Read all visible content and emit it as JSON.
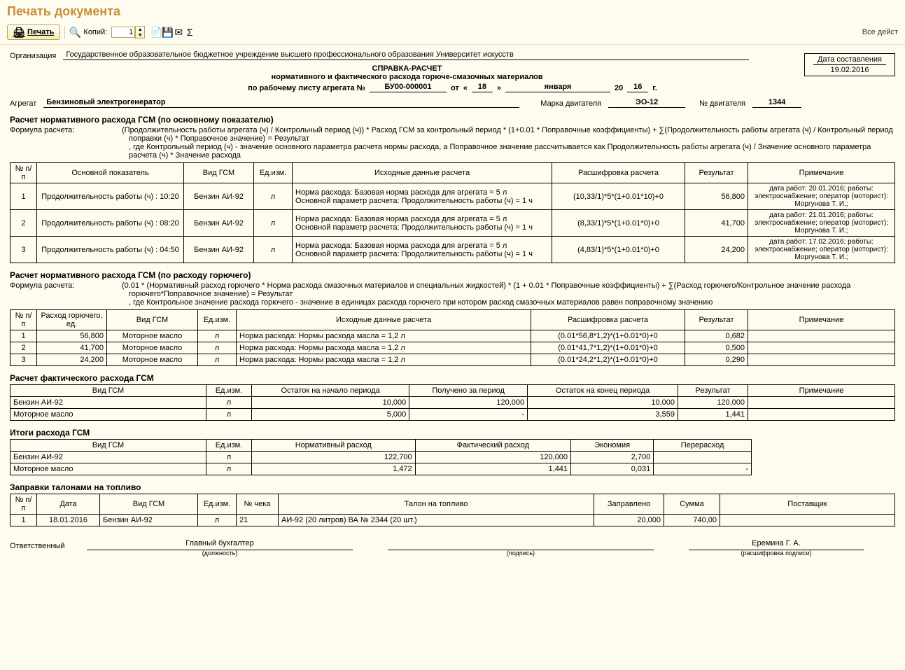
{
  "window_title": "Печать документа",
  "toolbar": {
    "print_label": "Печать",
    "copies_label": "Копий:",
    "copies_value": "1",
    "all_actions": "Все дейст"
  },
  "header": {
    "org_label": "Организация",
    "org_value": "Государственное образовательное бюджетное учреждение высшего профессионального образования  Университет искусств",
    "date_label": "Дата составления",
    "date_value": "19.02.2016",
    "title1": "СПРАВКА-РАСЧЕТ",
    "title2": "нормативного и фактического расхода горюче-смазочных материалов",
    "docline_prefix": "по рабочему листу агрегата  №",
    "doc_no": "БУ00-000001",
    "doc_ot": "от",
    "doc_day": "18",
    "doc_month": "января",
    "doc_year_prefix": "20",
    "doc_year": "16",
    "doc_year_suffix": "г.",
    "agg_label": "Агрегат",
    "agg_value": "Бензиновый электрогенератор",
    "engine_brand_label": "Марка двигателя",
    "engine_brand_value": "ЭО-12",
    "engine_no_label": "№ двигателя",
    "engine_no_value": "1344"
  },
  "section1": {
    "title": "Расчет нормативного расхода ГСМ (по основному показателю)",
    "formula_label": "Формула расчета:",
    "formula_text": "(Продолжительность работы агрегата (ч) / Контрольный период (ч)) * Расход ГСМ за контрольный период * (1+0.01 * Поправочные коэффициенты) + ∑(Продолжительность работы агрегата (ч) / Контрольный период поправки (ч) * Поправочное значение) = Результат\n, где Контрольный период (ч) - значение основного параметра расчета нормы расхода, а Поправочное значение рассчитывается как Продолжительность работы агрегата (ч) / Значение основного параметра расчета (ч) * Значение расхода",
    "cols": [
      "№ п/п",
      "Основной показатель",
      "Вид ГСМ",
      "Ед.изм.",
      "Исходные данные расчета",
      "Расшифровка расчета",
      "Результат",
      "Примечание"
    ],
    "rows": [
      {
        "n": "1",
        "ind": "Продолжительность работы (ч) : 10:20",
        "gsm": "Бензин АИ-92",
        "unit": "л",
        "src": "Норма расхода: Базовая норма расхода для агрегата = 5 л\nОсновной параметр расчета: Продолжительность работы (ч) = 1 ч",
        "calc": "(10,33/1)*5*(1+0.01*10)+0",
        "res": "56,800",
        "note": "дата работ: 20.01.2016; работы: электроснабжение; оператор (моторист): Моргунова Т. И.;"
      },
      {
        "n": "2",
        "ind": "Продолжительность работы (ч) : 08:20",
        "gsm": "Бензин АИ-92",
        "unit": "л",
        "src": "Норма расхода: Базовая норма расхода для агрегата = 5 л\nОсновной параметр расчета: Продолжительность работы (ч) = 1 ч",
        "calc": "(8,33/1)*5*(1+0.01*0)+0",
        "res": "41,700",
        "note": "дата работ: 21.01.2016; работы: электроснабжение; оператор (моторист): Моргунова Т. И.;"
      },
      {
        "n": "3",
        "ind": "Продолжительность работы (ч) : 04:50",
        "gsm": "Бензин АИ-92",
        "unit": "л",
        "src": "Норма расхода: Базовая норма расхода для агрегата = 5 л\nОсновной параметр расчета: Продолжительность работы (ч) = 1 ч",
        "calc": "(4,83/1)*5*(1+0.01*0)+0",
        "res": "24,200",
        "note": "дата работ: 17.02.2016; работы: электроснабжение; оператор (моторист): Моргунова Т. И.;"
      }
    ]
  },
  "section2": {
    "title": "Расчет нормативного расхода ГСМ (по расходу горючего)",
    "formula_label": "Формула расчета:",
    "formula_text": "(0.01 * (Нормативный расход горючего * Норма расхода смазочных материалов и специальных жидкостей) * (1 + 0.01 * Поправочные коэффициенты) + ∑(Расход горючего/Контрольное значение расхода горючего*Поправочное значение) = Результат\n, где Контрольное значение расхода горючего - значение в единицах расхода горючего при котором расход смазочных материалов равен поправочному значению",
    "cols": [
      "№ п/п",
      "Расход горючего, ед.",
      "Вид ГСМ",
      "Ед.изм.",
      "Исходные данные расчета",
      "Расшифровка расчета",
      "Результат",
      "Примечание"
    ],
    "rows": [
      {
        "n": "1",
        "fuel": "56,800",
        "gsm": "Моторное масло",
        "unit": "л",
        "src": "Норма расхода: Нормы расхода масла  = 1,2 л",
        "calc": "(0.01*56,8*1,2)*(1+0.01*0)+0",
        "res": "0,682",
        "note": ""
      },
      {
        "n": "2",
        "fuel": "41,700",
        "gsm": "Моторное масло",
        "unit": "л",
        "src": "Норма расхода: Нормы расхода масла  = 1,2 л",
        "calc": "(0.01*41,7*1,2)*(1+0.01*0)+0",
        "res": "0,500",
        "note": ""
      },
      {
        "n": "3",
        "fuel": "24,200",
        "gsm": "Моторное масло",
        "unit": "л",
        "src": "Норма расхода: Нормы расхода масла  = 1,2 л",
        "calc": "(0.01*24,2*1,2)*(1+0.01*0)+0",
        "res": "0,290",
        "note": ""
      }
    ]
  },
  "section3": {
    "title": "Расчет фактического расхода ГСМ",
    "cols": [
      "Вид ГСМ",
      "Ед.изм.",
      "Остаток на начало периода",
      "Получено за период",
      "Остаток на конец периода",
      "Результат",
      "Примечание"
    ],
    "rows": [
      {
        "gsm": "Бензин АИ-92",
        "unit": "л",
        "start": "10,000",
        "got": "120,000",
        "end": "10,000",
        "res": "120,000",
        "note": ""
      },
      {
        "gsm": "Моторное масло",
        "unit": "л",
        "start": "5,000",
        "got": "-",
        "end": "3,559",
        "res": "1,441",
        "note": ""
      }
    ]
  },
  "section4": {
    "title": "Итоги расхода ГСМ",
    "cols": [
      "Вид ГСМ",
      "Ед.изм.",
      "Нормативный расход",
      "Фактический расход",
      "Экономия",
      "Перерасход"
    ],
    "rows": [
      {
        "gsm": "Бензин АИ-92",
        "unit": "л",
        "norm": "122,700",
        "fact": "120,000",
        "econ": "2,700",
        "over": ""
      },
      {
        "gsm": "Моторное масло",
        "unit": "л",
        "norm": "1,472",
        "fact": "1,441",
        "econ": "0,031",
        "over": "-"
      }
    ]
  },
  "section5": {
    "title": "Заправки талонами на топливо",
    "cols": [
      "№ п/п",
      "Дата",
      "Вид ГСМ",
      "Ед.изм.",
      "№ чека",
      "Талон на топливо",
      "Заправлено",
      "Сумма",
      "Поставщик"
    ],
    "rows": [
      {
        "n": "1",
        "date": "18.01.2016",
        "gsm": "Бензин АИ-92",
        "unit": "л",
        "check": "21",
        "talon": "АИ-92 (20 литров) ВА № 2344 (20 шт.)",
        "fueled": "20,000",
        "sum": "740,00",
        "supplier": ""
      }
    ]
  },
  "sign": {
    "resp_label": "Ответственный",
    "position": "Главный бухгалтер",
    "name": "Еремина Г. А.",
    "cap_position": "(должность)",
    "cap_sign": "(подпись)",
    "cap_name": "(расшифровка подписи)"
  }
}
